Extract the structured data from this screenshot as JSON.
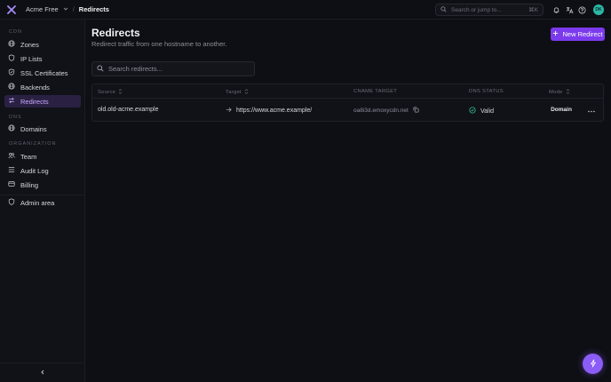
{
  "topbar": {
    "org_name": "Acme Free",
    "breadcrumb_sep": "/",
    "current_page": "Redirects",
    "search_placeholder": "Search or jump to...",
    "search_shortcut": "⌘K",
    "avatar_initials": "DK",
    "avatar_color": "#2bb7a6"
  },
  "sidebar": {
    "sections": {
      "cdn": "CDN",
      "dns": "DNS",
      "organization": "ORGANIZATION"
    },
    "items": [
      {
        "label": "Zones",
        "icon": "globe-icon"
      },
      {
        "label": "IP Lists",
        "icon": "shield-icon"
      },
      {
        "label": "SSL Certificates",
        "icon": "certificate-icon"
      },
      {
        "label": "Backends",
        "icon": "globe-icon"
      },
      {
        "label": "Redirects",
        "icon": "redirect-icon",
        "active": true
      },
      {
        "label": "Domains",
        "icon": "globe-icon"
      },
      {
        "label": "Team",
        "icon": "team-icon"
      },
      {
        "label": "Audit Log",
        "icon": "list-icon"
      },
      {
        "label": "Billing",
        "icon": "card-icon"
      },
      {
        "label": "Admin area",
        "icon": "shield-icon"
      }
    ]
  },
  "main": {
    "title": "Redirects",
    "subtitle": "Redirect traffic from one hostname to another.",
    "new_button": "New Redirect",
    "search_placeholder": "Search redirects...",
    "columns": {
      "source": "Source",
      "target": "Target",
      "cname": "CNAME TARGET",
      "dns_status": "DNS STATUS",
      "mode": "Mode"
    },
    "rows": [
      {
        "source": "old.old-acme.example",
        "target": "https://www.acme.example/",
        "cname": "oa8i3d.emoxycdn.net",
        "dns_status": "Valid",
        "mode": "Domain"
      }
    ]
  },
  "colors": {
    "accent": "#7c3aed",
    "active_nav_bg": "#2a2142",
    "status_valid": "#34d399"
  }
}
